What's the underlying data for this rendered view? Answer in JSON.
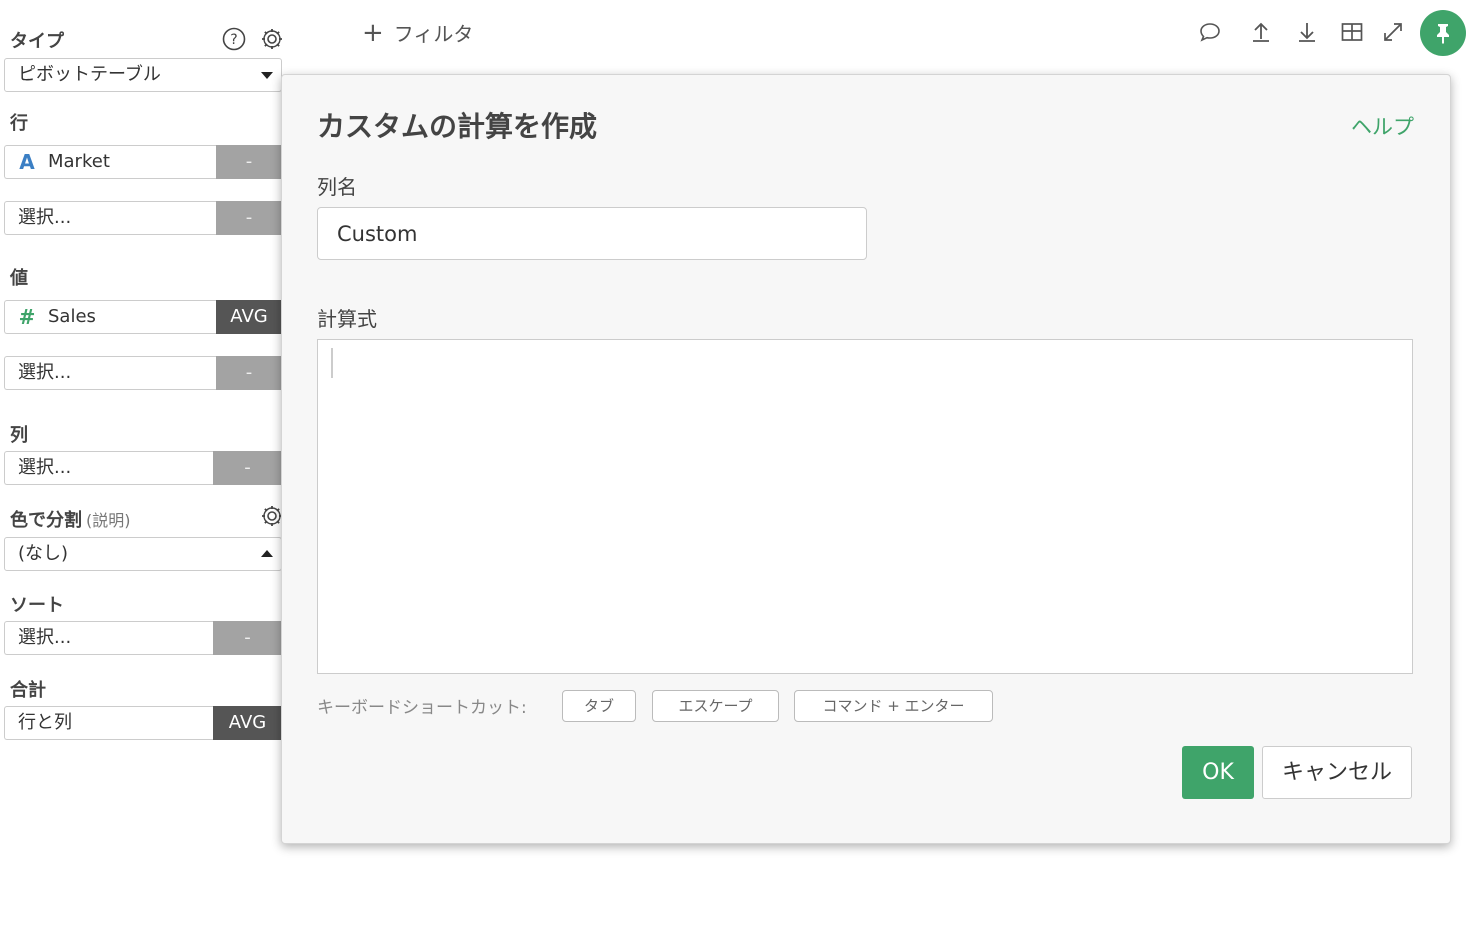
{
  "sidebar": {
    "type_label": "タイプ",
    "type_value": "ピボットテーブル",
    "rows_label": "行",
    "rows": [
      {
        "field": "Market",
        "kind": "A",
        "btn": "-"
      },
      {
        "field": "選択...",
        "kind": "",
        "btn": "-"
      }
    ],
    "values_label": "値",
    "values": [
      {
        "field": "Sales",
        "kind": "#",
        "btn": "AVG"
      },
      {
        "field": "選択...",
        "kind": "",
        "btn": "-"
      }
    ],
    "columns_label": "列",
    "columns": [
      {
        "field": "選択...",
        "btn": "-"
      }
    ],
    "color_label": "色で分割",
    "color_sub": "(説明)",
    "color_value": "(なし)",
    "sort_label": "ソート",
    "sort": [
      {
        "field": "選択...",
        "btn": "-"
      }
    ],
    "total_label": "合計",
    "total": {
      "field": "行と列",
      "btn": "AVG"
    }
  },
  "topbar": {
    "filter_label": "フィルタ",
    "icons": [
      "comment-icon",
      "upload-icon",
      "download-icon",
      "table-icon",
      "expand-icon",
      "pin-icon"
    ]
  },
  "dialog": {
    "title": "カスタムの計算を作成",
    "help": "ヘルプ",
    "name_label": "列名",
    "name_value": "Custom",
    "formula_label": "計算式",
    "formula_value": "",
    "shortcut_label": "キーボードショートカット:",
    "shortcuts": [
      "タブ",
      "エスケープ",
      "コマンド + エンター"
    ],
    "ok": "OK",
    "cancel": "キャンセル"
  },
  "colors": {
    "accent": "#3fa46a",
    "string_type": "#3b7fc4",
    "dark_btn": "#555555",
    "light_btn": "#a3a3a3"
  }
}
